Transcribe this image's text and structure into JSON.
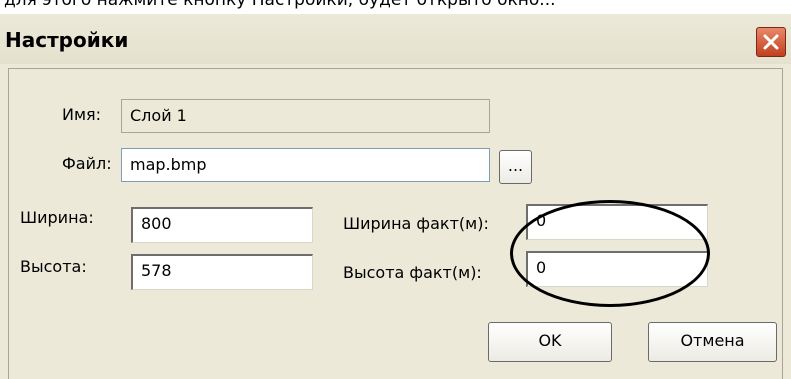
{
  "top_text": "для этого нажмите кнопку Настройки, будет открыто окно...",
  "dialog": {
    "title": "Настройки",
    "name_label": "Имя:",
    "name_value": "Слой 1",
    "file_label": "Файл:",
    "file_value": "map.bmp",
    "browse_label": "...",
    "width_label": "Ширина:",
    "width_value": "800",
    "height_label": "Высота:",
    "height_value": "578",
    "real_width_label": "Ширина факт(м):",
    "real_width_value": "0",
    "real_height_label": "Высота факт(м):",
    "real_height_value": "0",
    "ok_label": "OK",
    "cancel_label": "Отмена"
  },
  "icons": {
    "close": "close-icon"
  },
  "colors": {
    "dialog_bg": "#ece9d8",
    "close_button": "#d8542f",
    "input_border": "#7f9db9"
  }
}
